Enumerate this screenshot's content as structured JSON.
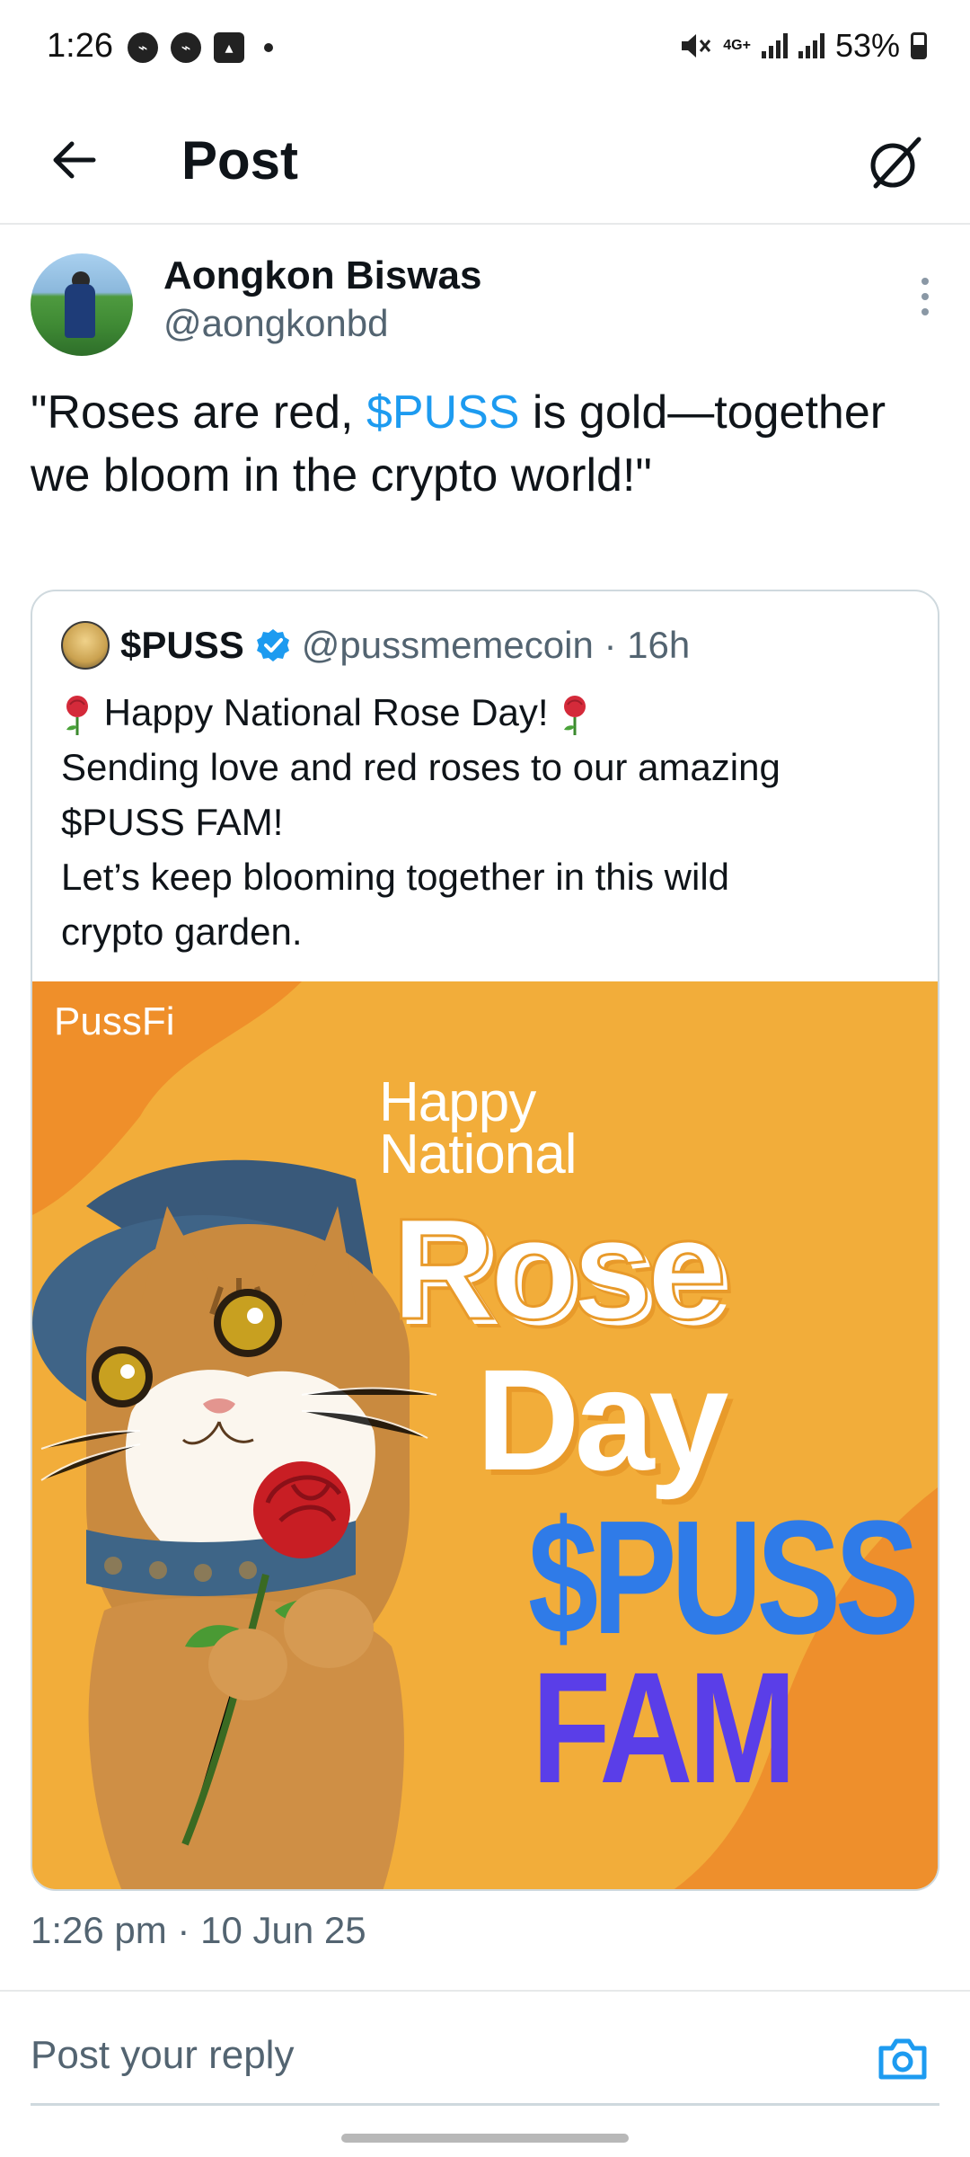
{
  "status_bar": {
    "time": "1:26",
    "network": "4G+",
    "battery": "53%"
  },
  "app_bar": {
    "title": "Post"
  },
  "post": {
    "author_name": "Aongkon Biswas",
    "author_handle": "@aongkonbd",
    "text_before": "\"Roses are red, ",
    "cashtag": "$PUSS",
    "text_after": " is gold—together we bloom in the crypto world!\"",
    "timestamp": "1:26 pm · 10 Jun 25"
  },
  "quoted_post": {
    "name": "$PUSS",
    "handle_time": "@pussmemecoin · 16h",
    "line1": "Happy National Rose Day!",
    "line2": "Sending love and red roses to our amazing",
    "line3": "$PUSS FAM!",
    "line4": "Let’s keep blooming together in this wild",
    "line5": "crypto garden.",
    "image": {
      "brand": "PussFi",
      "happy": "Happy",
      "national": "National",
      "rose": "Rose",
      "day": "Day",
      "puss": "$PUSS",
      "fam": "FAM"
    }
  },
  "reply": {
    "placeholder": "Post your reply"
  },
  "colors": {
    "accent": "#1d9bf0",
    "secondary_text": "#536471",
    "image_bg": "#f2ad3a"
  },
  "icons": [
    "back-arrow-icon",
    "grok-icon",
    "more-vertical-icon",
    "verified-badge-icon",
    "rose-icon",
    "camera-icon"
  ]
}
